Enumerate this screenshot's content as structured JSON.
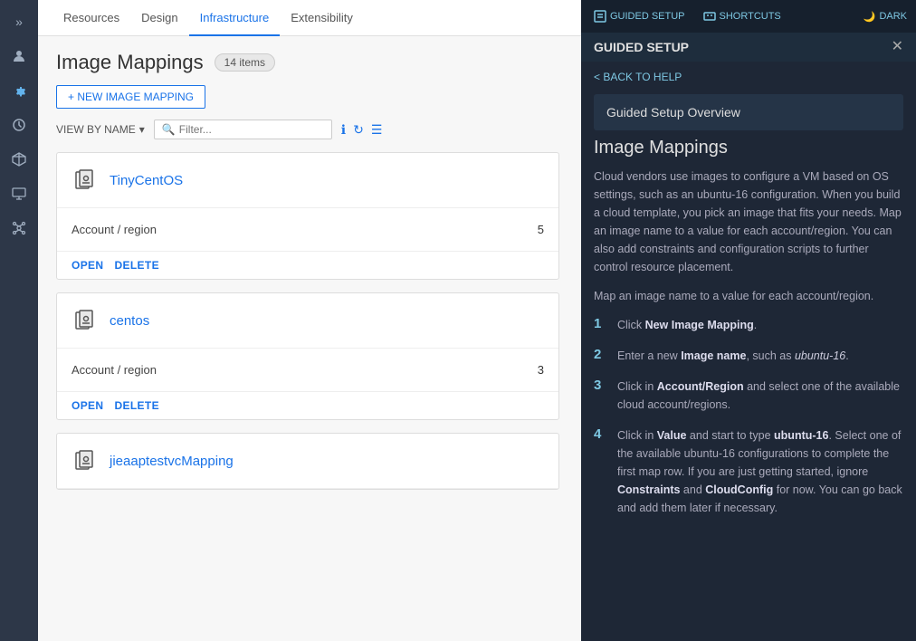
{
  "sidebar": {
    "icons": [
      {
        "name": "expand-icon",
        "symbol": "»",
        "active": false
      },
      {
        "name": "users-icon",
        "symbol": "👤",
        "active": false
      },
      {
        "name": "settings-icon",
        "symbol": "⚙",
        "active": false
      },
      {
        "name": "clock-icon",
        "symbol": "🕐",
        "active": false
      },
      {
        "name": "cube-icon",
        "symbol": "⬡",
        "active": false
      },
      {
        "name": "monitor-icon",
        "symbol": "▦",
        "active": false
      },
      {
        "name": "network-icon",
        "symbol": "⬡",
        "active": false
      }
    ]
  },
  "topnav": {
    "items": [
      {
        "label": "Resources",
        "active": false
      },
      {
        "label": "Design",
        "active": false
      },
      {
        "label": "Infrastructure",
        "active": true
      },
      {
        "label": "Extensibility",
        "active": false
      }
    ]
  },
  "page": {
    "title": "Image Mappings",
    "items_count": "14 items",
    "new_button": "+ NEW IMAGE MAPPING",
    "view_by": "VIEW BY NAME",
    "search_placeholder": "Filter..."
  },
  "cards": [
    {
      "name": "TinyCentOS",
      "rows": [
        {
          "label": "Account / region",
          "value": "5"
        }
      ],
      "actions": [
        "OPEN",
        "DELETE"
      ]
    },
    {
      "name": "centos",
      "rows": [
        {
          "label": "Account / region",
          "value": "3"
        }
      ],
      "actions": [
        "OPEN",
        "DELETE"
      ]
    },
    {
      "name": "jieaaptestvcMapping",
      "rows": [],
      "actions": []
    }
  ],
  "right_panel": {
    "topbar": {
      "guided_setup_label": "GUIDED SETUP",
      "shortcuts_label": "SHORTCUTS",
      "dark_label": "DARK"
    },
    "title": "GUIDED SETUP",
    "back_link": "< BACK TO HELP",
    "section_header": "Guided Setup Overview",
    "guide": {
      "heading": "Image Mappings",
      "intro": "Cloud vendors use images to configure a VM based on OS settings, such as an ubuntu-16 configuration. When you build a cloud template, you pick an image that fits your needs. Map an image name to a value for each account/region. You can also add constraints and configuration scripts to further control resource placement.",
      "subtext": "Map an image name to a value for each account/region.",
      "steps": [
        {
          "num": "1",
          "text": "Click <strong>New Image Mapping</strong>."
        },
        {
          "num": "2",
          "text": "Enter a new <strong>Image name</strong>, such as <em>ubuntu-16</em>."
        },
        {
          "num": "3",
          "text": "Click in <strong>Account/Region</strong> and select one of the available cloud account/regions."
        },
        {
          "num": "4",
          "text": "Click in <strong>Value</strong> and start to type <strong>ubuntu-16</strong>. Select one of the available ubuntu-16 configurations to complete the first map row. If you are just getting started, ignore <strong>Constraints</strong> and <strong>CloudConfig</strong> for now. You can go back and add them later if necessary."
        }
      ]
    },
    "close_label": "✕"
  }
}
